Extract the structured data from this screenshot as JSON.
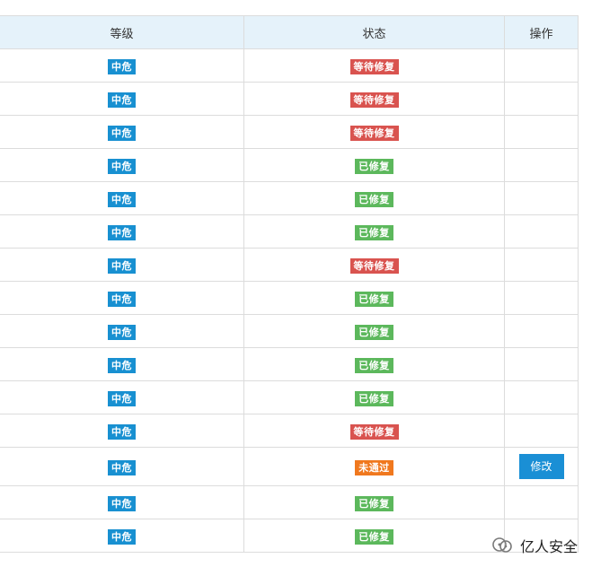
{
  "table": {
    "headers": {
      "level": "等级",
      "status": "状态",
      "operation": "操作"
    },
    "rows": [
      {
        "level": "中危",
        "status": "等待修复",
        "status_color": "red"
      },
      {
        "level": "中危",
        "status": "等待修复",
        "status_color": "red"
      },
      {
        "level": "中危",
        "status": "等待修复",
        "status_color": "red"
      },
      {
        "level": "中危",
        "status": "已修复",
        "status_color": "green"
      },
      {
        "level": "中危",
        "status": "已修复",
        "status_color": "green"
      },
      {
        "level": "中危",
        "status": "已修复",
        "status_color": "green"
      },
      {
        "level": "中危",
        "status": "等待修复",
        "status_color": "red"
      },
      {
        "level": "中危",
        "status": "已修复",
        "status_color": "green"
      },
      {
        "level": "中危",
        "status": "已修复",
        "status_color": "green"
      },
      {
        "level": "中危",
        "status": "已修复",
        "status_color": "green"
      },
      {
        "level": "中危",
        "status": "已修复",
        "status_color": "green"
      },
      {
        "level": "中危",
        "status": "等待修复",
        "status_color": "red"
      },
      {
        "level": "中危",
        "status": "未通过",
        "status_color": "orange",
        "action": "修改"
      },
      {
        "level": "中危",
        "status": "已修复",
        "status_color": "green"
      },
      {
        "level": "中危",
        "status": "已修复",
        "status_color": "green"
      }
    ]
  },
  "colors": {
    "level_badge": "#1890d1",
    "status_red": "#d9534f",
    "status_green": "#5cb85c",
    "status_orange": "#f0781e",
    "header_bg": "#e5f2fa",
    "button": "#1a8fd5"
  },
  "watermark": {
    "text": "亿人安全",
    "icon": "wechat-official-account-icon"
  }
}
